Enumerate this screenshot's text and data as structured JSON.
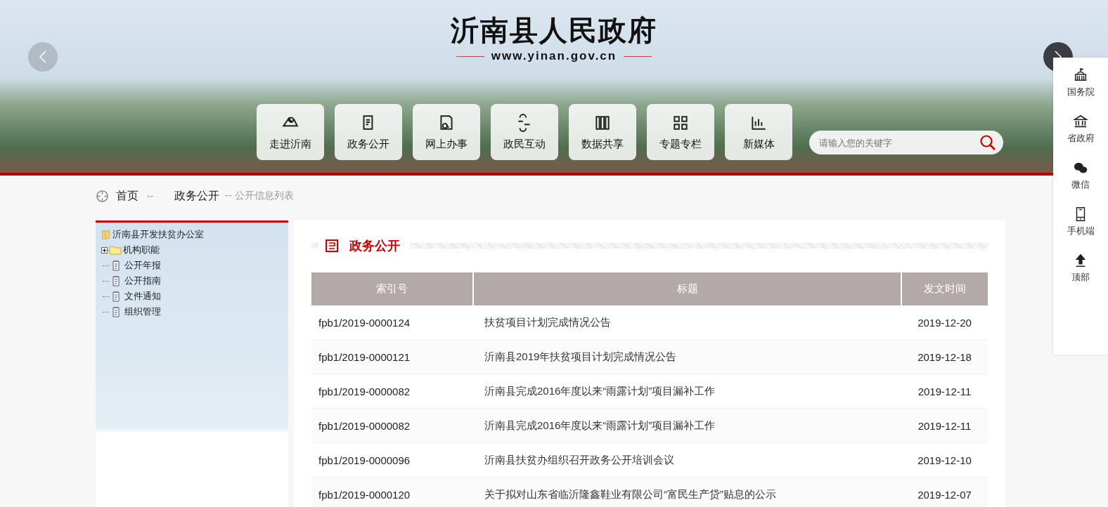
{
  "header": {
    "title": "沂南县人民政府",
    "url": "www.yinan.gov.cn"
  },
  "nav": [
    {
      "label": "走进沂南"
    },
    {
      "label": "政务公开"
    },
    {
      "label": "网上办事"
    },
    {
      "label": "政民互动"
    },
    {
      "label": "数据共享"
    },
    {
      "label": "专题专栏"
    },
    {
      "label": "新媒体"
    }
  ],
  "search": {
    "placeholder": "请输入您的关键字"
  },
  "breadcrumb": {
    "home": "首页",
    "sep1": "--",
    "section": "政务公开",
    "current": "-- 公开信息列表"
  },
  "tree": {
    "label": "沂南县开发扶贫办公室",
    "expanded": true,
    "children": [
      {
        "label": "机构职能",
        "kind": "folder",
        "expanded": false
      },
      {
        "label": "公开年报",
        "kind": "doc"
      },
      {
        "label": "公开指南",
        "kind": "doc"
      },
      {
        "label": "文件通知",
        "kind": "doc"
      },
      {
        "label": "组织管理",
        "kind": "doc"
      }
    ]
  },
  "section_title": "政务公开",
  "table": {
    "columns": [
      "索引号",
      "标题",
      "发文时间"
    ],
    "rows": [
      [
        "fpb1/2019-0000124",
        "扶贫项目计划完成情况公告",
        "2019-12-20"
      ],
      [
        "fpb1/2019-0000121",
        "沂南县2019年扶贫项目计划完成情况公告",
        "2019-12-18"
      ],
      [
        "fpb1/2019-0000082",
        "沂南县完成2016年度以来“雨露计划”项目漏补工作",
        "2019-12-11"
      ],
      [
        "fpb1/2019-0000082",
        "沂南县完成2016年度以来“雨露计划”项目漏补工作",
        "2019-12-11"
      ],
      [
        "fpb1/2019-0000096",
        "沂南县扶贫办组织召开政务公开培训会议",
        "2019-12-10"
      ],
      [
        "fpb1/2019-0000120",
        "关于拟对山东省临沂隆鑫鞋业有限公司“富民生产贷”贴息的公示",
        "2019-12-07"
      ]
    ]
  },
  "float_bar": [
    {
      "label": "国务院"
    },
    {
      "label": "省政府"
    },
    {
      "label": "微信"
    },
    {
      "label": "手机端"
    },
    {
      "label": "顶部"
    }
  ]
}
